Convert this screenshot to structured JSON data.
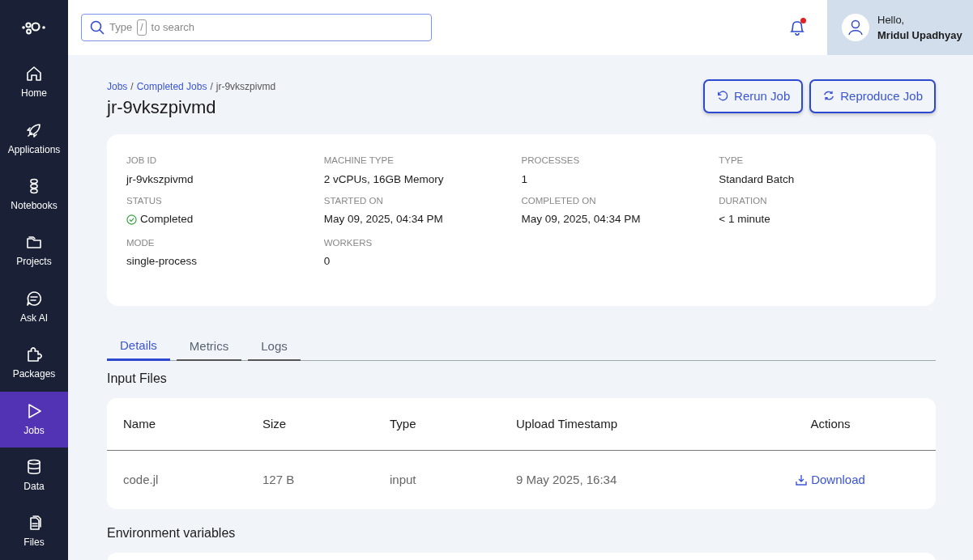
{
  "sidebar": {
    "items": [
      {
        "label": "Home",
        "selected": false
      },
      {
        "label": "Applications",
        "selected": false
      },
      {
        "label": "Notebooks",
        "selected": false
      },
      {
        "label": "Projects",
        "selected": false
      },
      {
        "label": "Ask AI",
        "selected": false
      },
      {
        "label": "Packages",
        "selected": false
      },
      {
        "label": "Jobs",
        "selected": true
      },
      {
        "label": "Data",
        "selected": false
      },
      {
        "label": "Files",
        "selected": false
      }
    ]
  },
  "topbar": {
    "search": {
      "hint_start": "Type",
      "hint_key": "/",
      "hint_end": "to search"
    },
    "notifications": {
      "unread": true
    },
    "user": {
      "greeting": "Hello,",
      "name": "Mridul Upadhyay"
    }
  },
  "breadcrumb": {
    "separator": "/",
    "items": [
      {
        "label": "Jobs",
        "link": true
      },
      {
        "label": "Completed Jobs",
        "link": true
      },
      {
        "label": "jr-9vkszpivmd",
        "link": false
      }
    ]
  },
  "page_title": "jr-9vkszpivmd",
  "actions": [
    "Rerun Job",
    "Reproduce Job"
  ],
  "details": [
    {
      "label": "JOB ID",
      "value": "jr-9vkszpivmd",
      "kind": "text"
    },
    {
      "label": "MACHINE TYPE",
      "value": "2 vCPUs, 16GB Memory",
      "kind": "text"
    },
    {
      "label": "PROCESSES",
      "value": "1",
      "kind": "text"
    },
    {
      "label": "TYPE",
      "value": "Standard Batch",
      "kind": "text"
    },
    {
      "label": "STATUS",
      "value": "Completed",
      "kind": "status"
    },
    {
      "label": "STARTED ON",
      "value": "May 09, 2025, 04:34 PM",
      "kind": "text"
    },
    {
      "label": "COMPLETED ON",
      "value": "May 09, 2025, 04:34 PM",
      "kind": "text"
    },
    {
      "label": "DURATION",
      "value": "< 1 minute",
      "kind": "text"
    },
    {
      "label": "MODE",
      "value": "single-process",
      "kind": "text"
    },
    {
      "label": "WORKERS",
      "value": "0",
      "kind": "text"
    }
  ],
  "tabs": [
    {
      "label": "Details",
      "selected": true
    },
    {
      "label": "Metrics",
      "selected": false
    },
    {
      "label": "Logs",
      "selected": false
    }
  ],
  "input_files": {
    "title": "Input Files",
    "columns": [
      "Name",
      "Size",
      "Type",
      "Upload Timestamp",
      "Actions"
    ],
    "rows": [
      {
        "cells": [
          "code.jl",
          "127 B",
          "input",
          "9 May 2025, 16:34"
        ],
        "action": "Download"
      }
    ]
  },
  "environment_variables": {
    "title": "Environment variables"
  }
}
